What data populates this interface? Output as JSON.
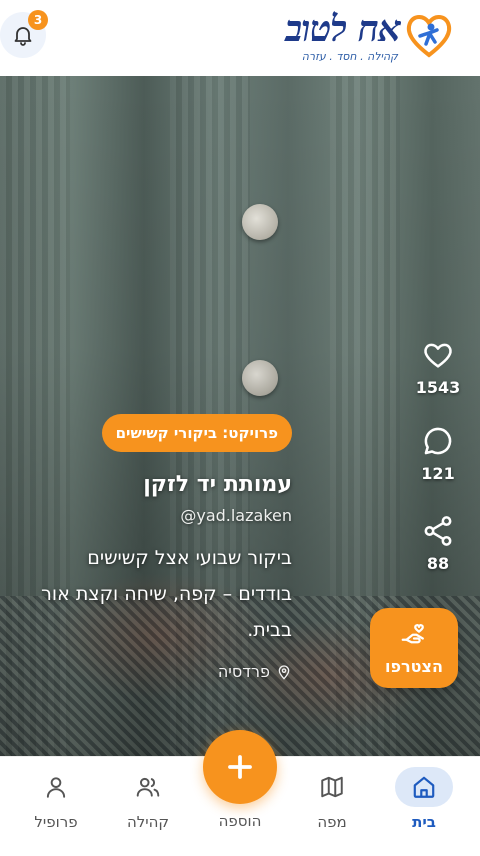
{
  "header": {
    "logo_text": "אח לטוב",
    "logo_tagline": "קהילה . חסד . עזרה",
    "notification_count": "3"
  },
  "post": {
    "project_label": "פרויקט: ביקורי קשישים",
    "org_name": "עמותת יד לזקן",
    "org_handle": "@yad.lazaken",
    "description": "ביקור שבועי אצל קשישים בודדים – קפה, שיחה וקצת אור בבית.",
    "location": "פרדסיה"
  },
  "actions": {
    "likes": "1543",
    "comments": "121",
    "shares": "88",
    "join_label": "הצטרפו"
  },
  "nav": {
    "home": "בית",
    "map": "מפה",
    "add": "הוספה",
    "community": "קהילה",
    "profile": "פרופיל"
  },
  "colors": {
    "accent": "#f7931e",
    "brand": "#1e3a8a",
    "nav_active": "#1e5bbf"
  }
}
